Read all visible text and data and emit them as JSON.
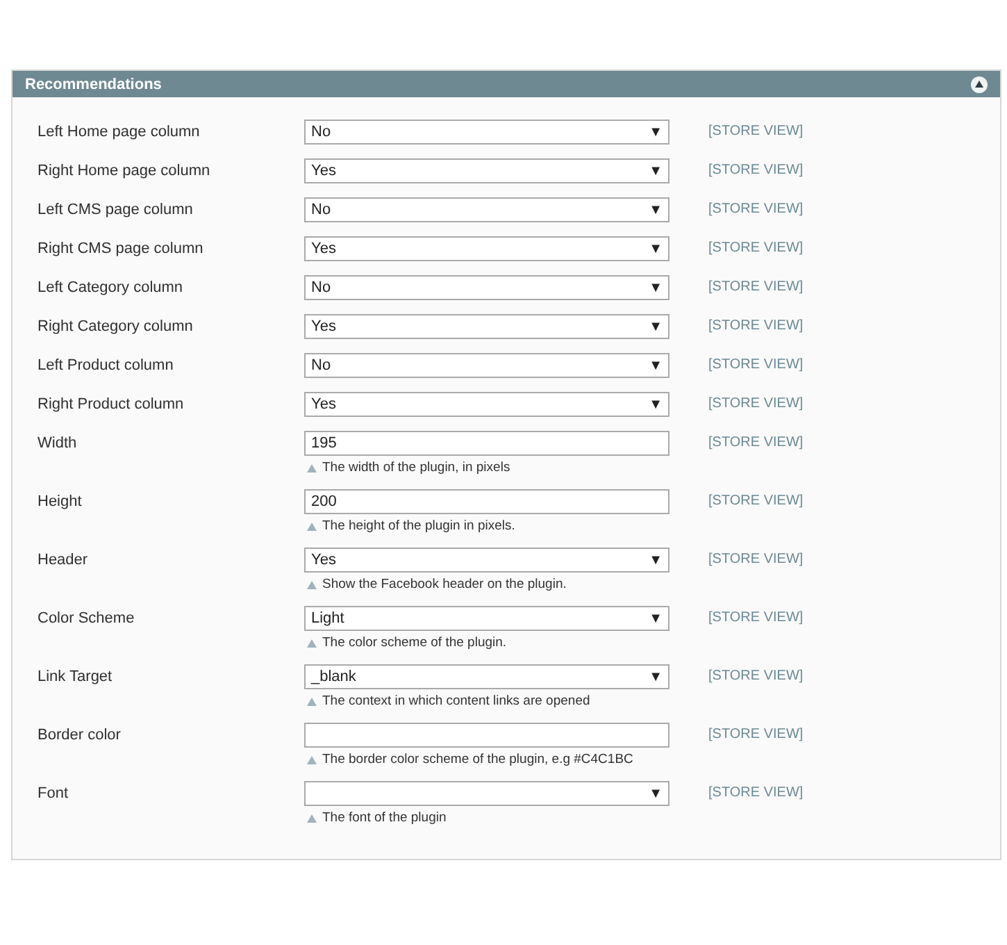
{
  "section": {
    "title": "Recommendations",
    "expanded": true
  },
  "rows": [
    {
      "label": "Left Home page column",
      "kind": "select",
      "value": "No",
      "arrow": "▼",
      "scope": "[STORE VIEW]"
    },
    {
      "label": "Right Home page column",
      "kind": "select",
      "value": "Yes",
      "arrow": "▼",
      "scope": "[STORE VIEW]"
    },
    {
      "label": "Left CMS page column",
      "kind": "select",
      "value": "No",
      "arrow": "▼",
      "scope": "[STORE VIEW]"
    },
    {
      "label": "Right CMS page column",
      "kind": "select",
      "value": "Yes",
      "arrow": "▼",
      "scope": "[STORE VIEW]"
    },
    {
      "label": "Left Category column",
      "kind": "select",
      "value": "No",
      "arrow": "▼",
      "scope": "[STORE VIEW]"
    },
    {
      "label": "Right Category column",
      "kind": "select",
      "value": "Yes",
      "arrow": "▼",
      "scope": "[STORE VIEW]"
    },
    {
      "label": "Left Product column",
      "kind": "select",
      "value": "No",
      "arrow": "▼",
      "scope": "[STORE VIEW]"
    },
    {
      "label": "Right Product column",
      "kind": "select",
      "value": "Yes",
      "arrow": "▼",
      "scope": "[STORE VIEW]"
    },
    {
      "label": "Width",
      "kind": "text",
      "value": "195",
      "scope": "[STORE VIEW]",
      "note": "The width of the plugin, in pixels"
    },
    {
      "label": "Height",
      "kind": "text",
      "value": "200",
      "scope": "[STORE VIEW]",
      "note": "The height of the plugin in pixels."
    },
    {
      "label": "Header",
      "kind": "select",
      "value": "Yes",
      "arrow": "▼",
      "scope": "[STORE VIEW]",
      "note": "Show the Facebook header on the plugin."
    },
    {
      "label": "Color Scheme",
      "kind": "select",
      "value": "Light",
      "arrow": "▼",
      "scope": "[STORE VIEW]",
      "note": "The color scheme of the plugin."
    },
    {
      "label": "Link Target",
      "kind": "select",
      "value": "_blank",
      "arrow": "▼",
      "scope": "[STORE VIEW]",
      "note": "The context in which content links are opened"
    },
    {
      "label": "Border color",
      "kind": "text",
      "scope": "[STORE VIEW]",
      "note": "The border color scheme of the plugin, e.g #C4C1BC"
    },
    {
      "label": "Font",
      "kind": "select",
      "arrow": "▼",
      "scope": "[STORE VIEW]",
      "note": "The font of the plugin"
    }
  ]
}
